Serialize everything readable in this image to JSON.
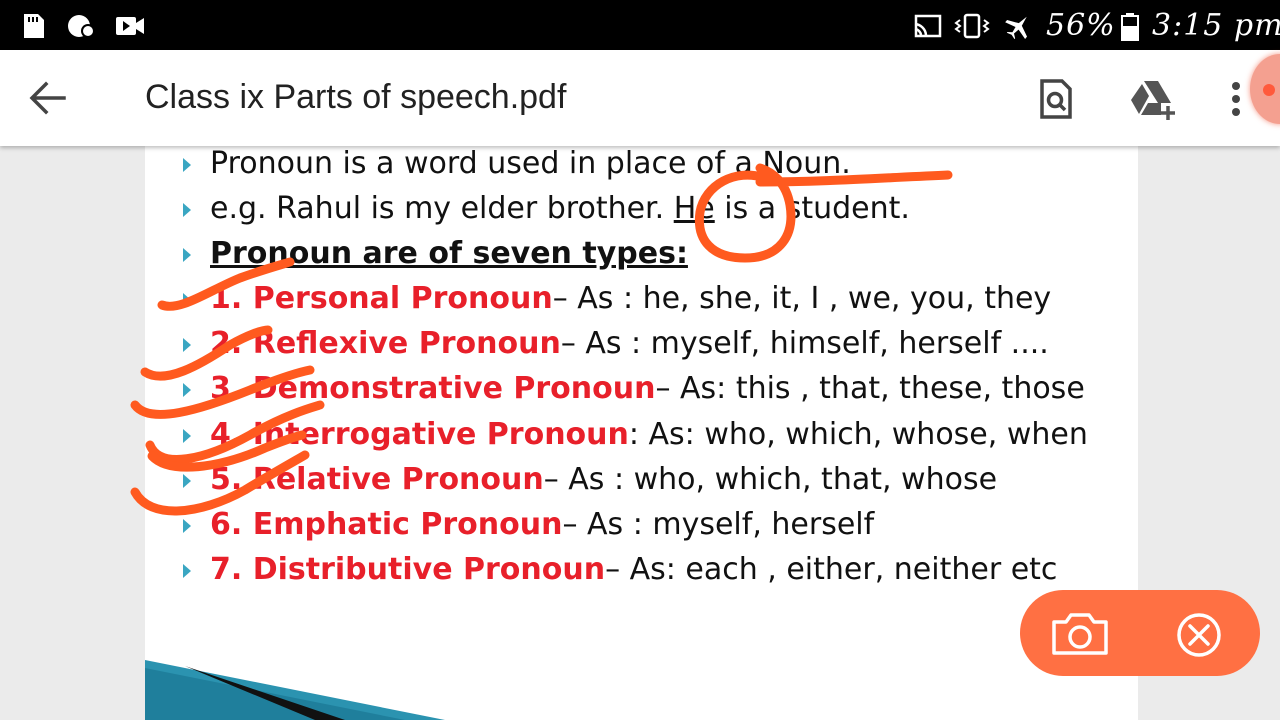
{
  "status_bar": {
    "battery": "56%",
    "time": "3:15 pm",
    "icons": [
      "sd-card-icon",
      "data-saver-icon",
      "video-icon",
      "cast-icon",
      "vibrate-icon",
      "airplane-mode-icon",
      "battery-icon"
    ]
  },
  "app_bar": {
    "title": "Class ix Parts of speech.pdf",
    "icons": [
      "back-arrow-icon",
      "find-in-document-icon",
      "add-to-drive-icon",
      "more-vert-icon"
    ]
  },
  "document": {
    "line1": "Pronoun is a word used in place of a Noun.",
    "line2_a": "e.g. Rahul is my elder brother. ",
    "line2_b": "He",
    "line2_c": " is a student.",
    "line3": "Pronoun are of seven types:",
    "types": [
      {
        "label": "1. Personal Pronoun",
        "rest": "– As : he, she, it, I , we, you, they"
      },
      {
        "label": "2. Reflexive Pronoun",
        "rest": "– As : myself, himself, herself ...."
      },
      {
        "label": "3. Demonstrative Pronoun",
        "rest": "– As: this , that, these, those"
      },
      {
        "label": "4. Interrogative Pronoun",
        "rest": ": As: who, which, whose, when"
      },
      {
        "label": "5. Relative Pronoun",
        "rest": "– As : who, which, that, whose"
      },
      {
        "label": "6. Emphatic Pronoun",
        "rest": "– As : myself, herself"
      },
      {
        "label": "7. Distributive Pronoun",
        "rest": "– As: each , either, neither etc"
      }
    ]
  },
  "colors": {
    "accent_red": "#e8202a",
    "bullet": "#3aa6c2",
    "annotation": "#ff5a1f",
    "float_bar": "#ff7043"
  },
  "floating_controls": {
    "icons": [
      "camera-icon",
      "close-circle-icon"
    ]
  }
}
